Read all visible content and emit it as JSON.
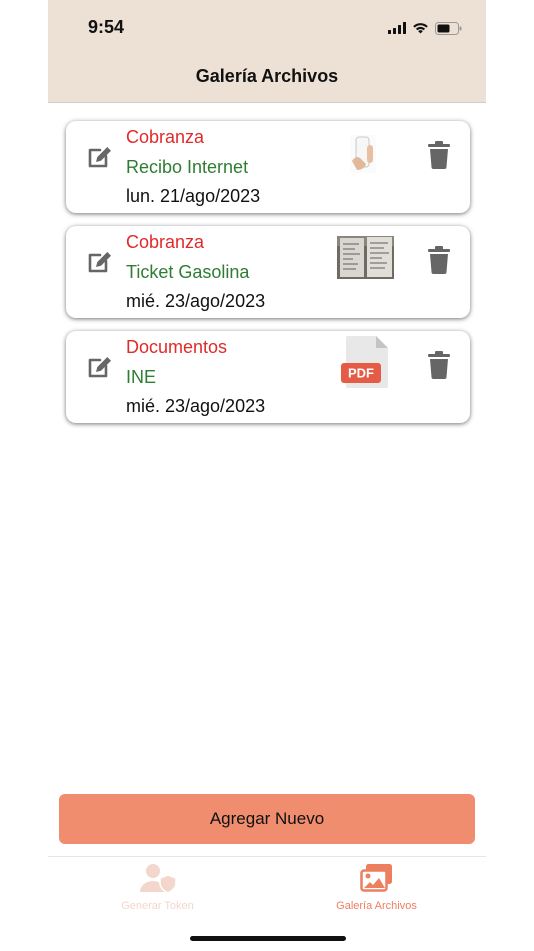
{
  "status": {
    "time": "9:54"
  },
  "header": {
    "title": "Galería Archivos"
  },
  "files": [
    {
      "category": "Cobranza",
      "name": "Recibo Internet",
      "date": "lun. 21/ago/2023",
      "thumb": "phone-photo"
    },
    {
      "category": "Cobranza",
      "name": "Ticket Gasolina",
      "date": "mié. 23/ago/2023",
      "thumb": "receipt-photo"
    },
    {
      "category": "Documentos",
      "name": "INE",
      "date": "mié. 23/ago/2023",
      "thumb": "pdf-icon"
    }
  ],
  "pdf_label": "PDF",
  "add_button": {
    "label": "Agregar Nuevo"
  },
  "tabs": [
    {
      "label": "Generar Token",
      "icon": "user-shield-icon",
      "active": false
    },
    {
      "label": "Galería Archivos",
      "icon": "images-icon",
      "active": true
    }
  ],
  "colors": {
    "accent": "#f08d6e",
    "header_bg": "#ede1d6",
    "category": "#e12a2a",
    "name": "#2e7d32"
  }
}
